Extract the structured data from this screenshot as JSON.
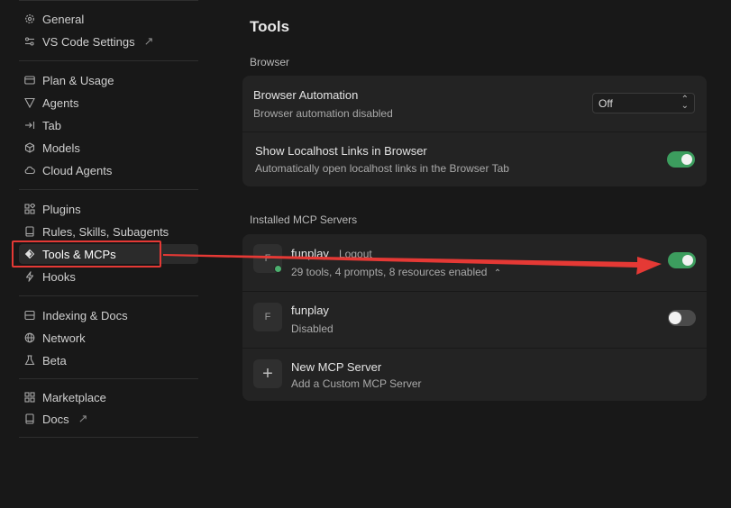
{
  "sidebar": {
    "groups": [
      [
        {
          "label": "General",
          "icon": "gear-icon"
        },
        {
          "label": "VS Code Settings",
          "icon": "settings-link-icon",
          "external": "↗"
        }
      ],
      [
        {
          "label": "Plan & Usage",
          "icon": "card-icon"
        },
        {
          "label": "Agents",
          "icon": "agents-icon"
        },
        {
          "label": "Tab",
          "icon": "tab-arrow-icon"
        },
        {
          "label": "Models",
          "icon": "cube-icon"
        },
        {
          "label": "Cloud Agents",
          "icon": "cloud-icon"
        }
      ],
      [
        {
          "label": "Plugins",
          "icon": "puzzle-icon"
        },
        {
          "label": "Rules, Skills, Subagents",
          "icon": "book-icon"
        },
        {
          "label": "Tools & MCPs",
          "icon": "tools-icon",
          "active": true
        },
        {
          "label": "Hooks",
          "icon": "hook-icon"
        }
      ],
      [
        {
          "label": "Indexing & Docs",
          "icon": "database-icon"
        },
        {
          "label": "Network",
          "icon": "globe-icon"
        },
        {
          "label": "Beta",
          "icon": "flask-icon"
        }
      ],
      [
        {
          "label": "Marketplace",
          "icon": "store-icon"
        },
        {
          "label": "Docs",
          "icon": "docs-icon",
          "external": "↗"
        }
      ]
    ]
  },
  "main": {
    "title": "Tools",
    "browser": {
      "section_label": "Browser",
      "automation": {
        "title": "Browser Automation",
        "subtitle": "Browser automation disabled",
        "select_value": "Off"
      },
      "localhost": {
        "title": "Show Localhost Links in Browser",
        "subtitle": "Automatically open localhost links in the Browser Tab",
        "enabled": true
      }
    },
    "mcp": {
      "section_label": "Installed MCP Servers",
      "servers": [
        {
          "avatar": "F",
          "name": "funplay",
          "action": "Logout",
          "subtitle": "29 tools, 4 prompts, 8 resources enabled",
          "expand": "⌃",
          "enabled": true,
          "status": "connected"
        },
        {
          "avatar": "F",
          "name": "funplay",
          "subtitle": "Disabled",
          "enabled": false
        }
      ],
      "add": {
        "icon": "plus-icon",
        "symbol": "+",
        "title": "New MCP Server",
        "subtitle": "Add a Custom MCP Server"
      }
    }
  },
  "annotation": {
    "color": "#e53935"
  },
  "colors": {
    "accent_green": "#3c9d5e",
    "background": "#181818",
    "card": "#232323"
  }
}
